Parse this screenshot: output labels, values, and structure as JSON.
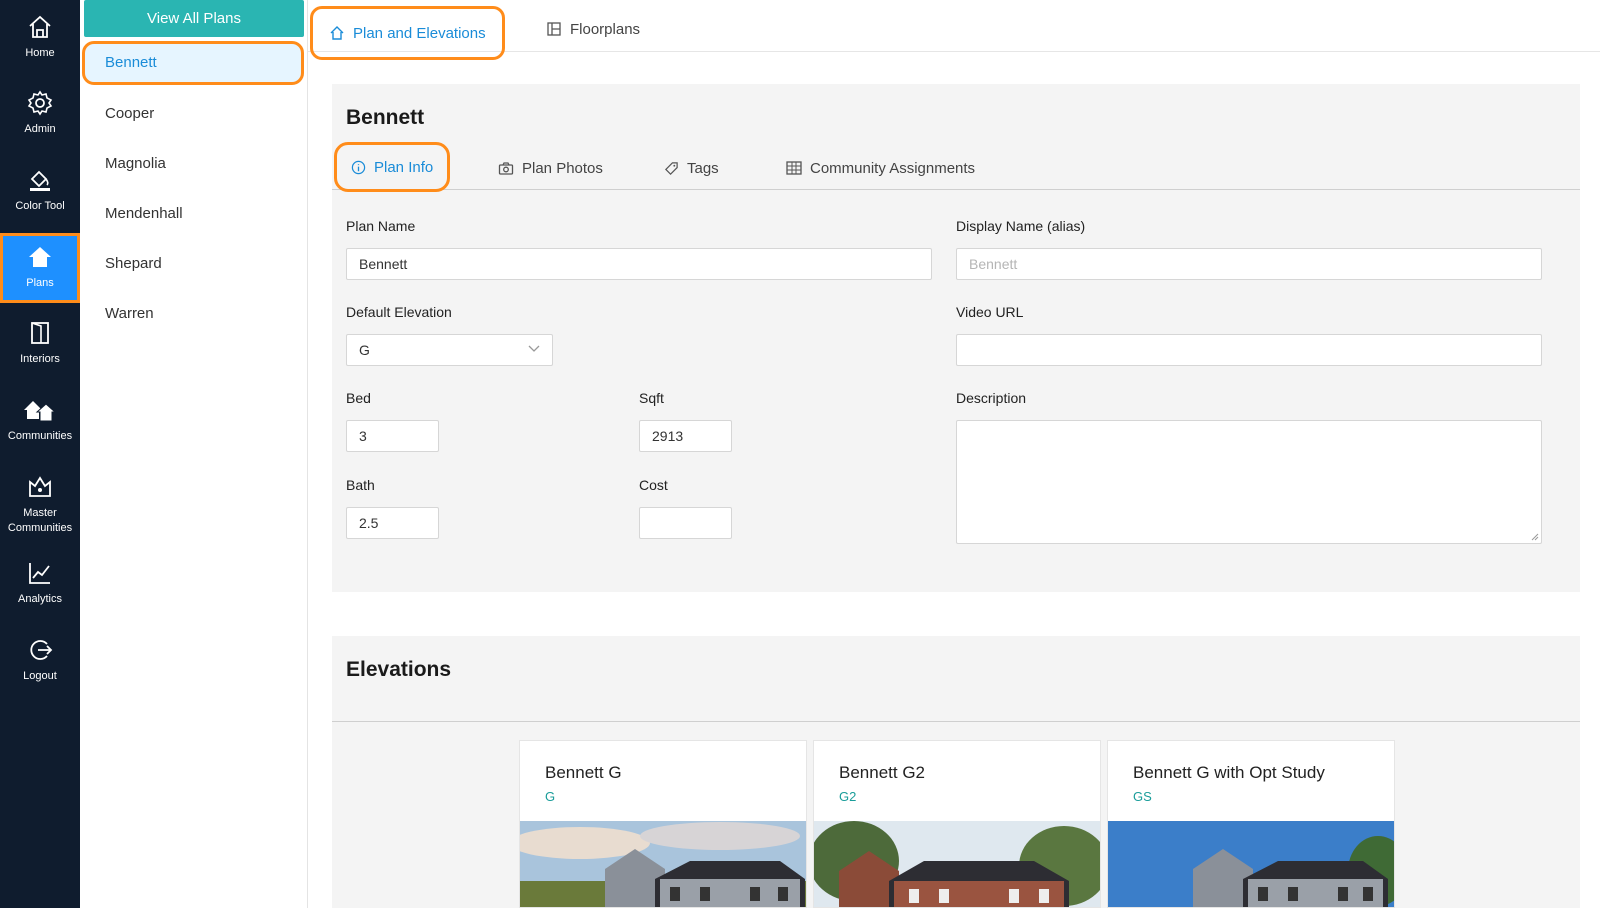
{
  "nav": {
    "items": [
      {
        "label": "Home",
        "icon": "home-icon"
      },
      {
        "label": "Admin",
        "icon": "gear-icon"
      },
      {
        "label": "Color Tool",
        "icon": "paint-bucket-icon"
      },
      {
        "label": "Plans",
        "icon": "house-icon"
      },
      {
        "label": "Interiors",
        "icon": "door-icon"
      },
      {
        "label": "Communities",
        "icon": "houses-icon"
      },
      {
        "label": "Master Communities",
        "label_line1": "Master",
        "label_line2": "Communities",
        "icon": "crown-house-icon"
      },
      {
        "label": "Analytics",
        "icon": "chart-icon"
      },
      {
        "label": "Logout",
        "icon": "logout-icon"
      }
    ],
    "active": "Plans"
  },
  "plans": {
    "view_all_label": "View All Plans",
    "items": [
      "Bennett",
      "Cooper",
      "Magnolia",
      "Mendenhall",
      "Shepard",
      "Warren"
    ],
    "selected": "Bennett"
  },
  "top_tabs": {
    "plan_elevations": "Plan and Elevations",
    "floorplans": "Floorplans"
  },
  "plan": {
    "title": "Bennett",
    "sub_tabs": {
      "plan_info": "Plan Info",
      "plan_photos": "Plan Photos",
      "tags": "Tags",
      "community_assignments": "Community Assignments"
    },
    "fields": {
      "plan_name_label": "Plan Name",
      "plan_name_value": "Bennett",
      "display_name_label": "Display Name (alias)",
      "display_name_placeholder": "Bennett",
      "default_elevation_label": "Default Elevation",
      "default_elevation_value": "G",
      "video_url_label": "Video URL",
      "video_url_value": "",
      "bed_label": "Bed",
      "bed_value": "3",
      "sqft_label": "Sqft",
      "sqft_value": "2913",
      "bath_label": "Bath",
      "bath_value": "2.5",
      "cost_label": "Cost",
      "cost_value": "",
      "description_label": "Description",
      "description_value": ""
    }
  },
  "elevations": {
    "title": "Elevations",
    "cards": [
      {
        "name": "Bennett G",
        "code": "G"
      },
      {
        "name": "Bennett G2",
        "code": "G2"
      },
      {
        "name": "Bennett G with Opt Study",
        "code": "GS"
      }
    ]
  },
  "colors": {
    "accent_blue": "#1a8cd8",
    "teal": "#2ab5b2",
    "highlight_orange": "#ff8c1a",
    "rail_bg": "#0f1c2e"
  }
}
